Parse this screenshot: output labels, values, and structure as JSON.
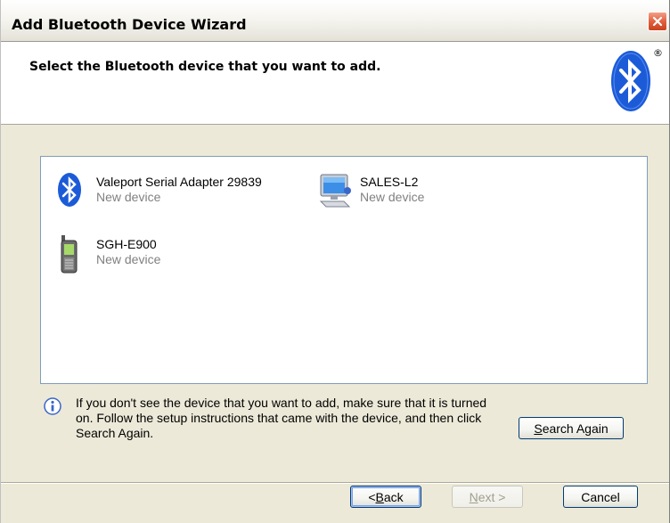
{
  "window": {
    "title": "Add Bluetooth Device Wizard"
  },
  "header": {
    "title": "Select the Bluetooth device that you want to add.",
    "registered_mark": "®"
  },
  "devices": [
    {
      "name": "Valeport Serial Adapter 29839",
      "status": "New device",
      "icon": "bluetooth-icon"
    },
    {
      "name": "SALES-L2",
      "status": "New device",
      "icon": "computer-icon"
    },
    {
      "name": "SGH-E900",
      "status": "New device",
      "icon": "phone-icon"
    }
  ],
  "hint": {
    "text": "If you don't see the device that you want to add, make sure that it is turned on. Follow the setup instructions that came with the device, and then click Search Again.",
    "icon": "info-icon"
  },
  "buttons": {
    "search_again": {
      "prefix": "",
      "accel": "S",
      "suffix": "earch Again"
    },
    "back": {
      "prefix": "< ",
      "accel": "B",
      "suffix": "ack"
    },
    "next": {
      "prefix": "",
      "accel": "N",
      "suffix": "ext >"
    },
    "cancel": {
      "label": "Cancel"
    }
  },
  "colors": {
    "dialog_bg": "#ece9d8",
    "bluetooth_blue": "#1c5bd8",
    "close_red": "#e2613f",
    "muted_text": "#808080"
  }
}
